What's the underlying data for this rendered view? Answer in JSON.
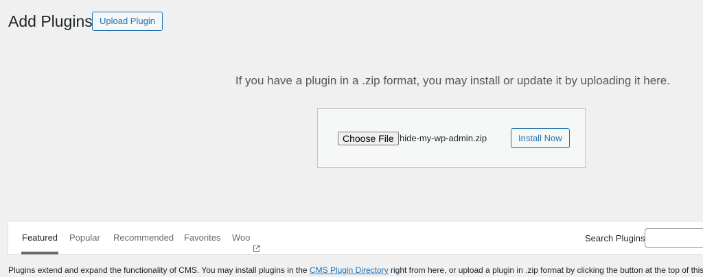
{
  "header": {
    "title": "Add Plugins",
    "upload_button_label": "Upload Plugin"
  },
  "upload": {
    "help_text": "If you have a plugin in a .zip format, you may install or update it by uploading it here.",
    "choose_file_label": "Choose File",
    "file_name": "hide-my-wp-admin.zip",
    "install_button_label": "Install Now"
  },
  "filters": {
    "tabs": [
      {
        "label": "Featured",
        "current": true
      },
      {
        "label": "Popular",
        "current": false
      },
      {
        "label": "Recommended",
        "current": false
      },
      {
        "label": "Favorites",
        "current": false
      },
      {
        "label": "Woo",
        "current": false,
        "external": true,
        "icon": "external-link-icon"
      }
    ],
    "search_label": "Search Plugins",
    "search_value": ""
  },
  "description": {
    "before_link": "Plugins extend and expand the functionality of CMS. You may install plugins in the ",
    "link_text": "CMS Plugin Directory",
    "after_link": " right from here, or upload a plugin in .zip format by clicking the button at the top of this page."
  },
  "colors": {
    "accent": "#2271b1",
    "background": "#f0f0f1",
    "text": "#1d2327",
    "muted_text": "#646970"
  }
}
